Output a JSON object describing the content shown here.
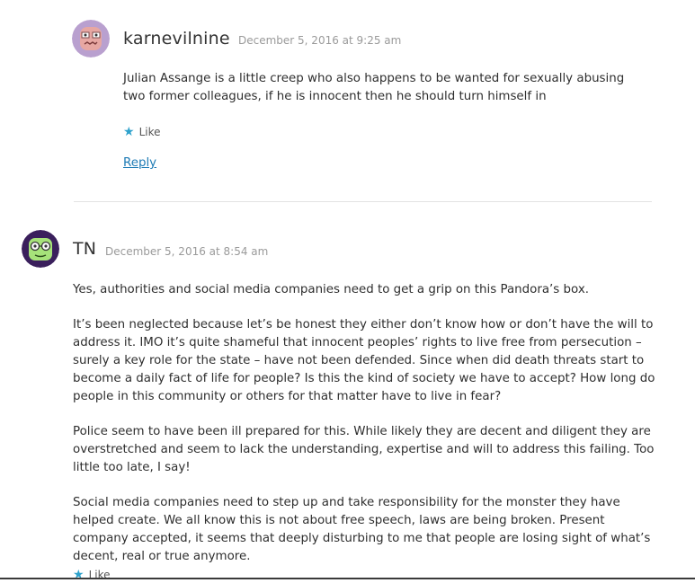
{
  "comments": [
    {
      "author": "karnevilnine",
      "date": "December 5, 2016 at 9:25 am",
      "avatar_icon": "monster-avatar-pink-icon",
      "paragraphs": [
        "Julian Assange is a little creep who also happens to be wanted for sexually abusing two former colleagues, if he is innocent then he should turn himself in"
      ],
      "like_label": "Like",
      "reply_label": "Reply"
    },
    {
      "author": "TN",
      "date": "December 5, 2016 at 8:54 am",
      "avatar_icon": "monster-avatar-green-icon",
      "paragraphs": [
        "Yes, authorities and social media companies need to get a grip on this Pandora’s box.",
        "It’s been neglected because let’s be honest they either don’t know how or don’t have the will to address it. IMO it’s quite shameful that innocent peoples’ rights to live free from persecution – surely a key role for the state – have not been defended. Since when did death threats start to become a daily fact of life for people? Is this the kind of society we have to accept? How long do people in this community or others for that matter have to live in fear?",
        "Police seem to have been ill prepared for this. While likely they are decent and diligent they are overstretched and seem to lack the understanding, expertise and will to address this failing. Too little too late, I say!",
        "Social media companies need to step up and take responsibility for the monster they have helped create. We all know this is not about free speech, laws are being broken. Present company accepted, it seems that deeply disturbing to me that people are losing sight of what’s decent, real or true anymore."
      ],
      "like_label": "Like"
    }
  ],
  "colors": {
    "link": "#1e7bb5",
    "star": "#2ea2cc",
    "date": "#9a9a9a"
  }
}
